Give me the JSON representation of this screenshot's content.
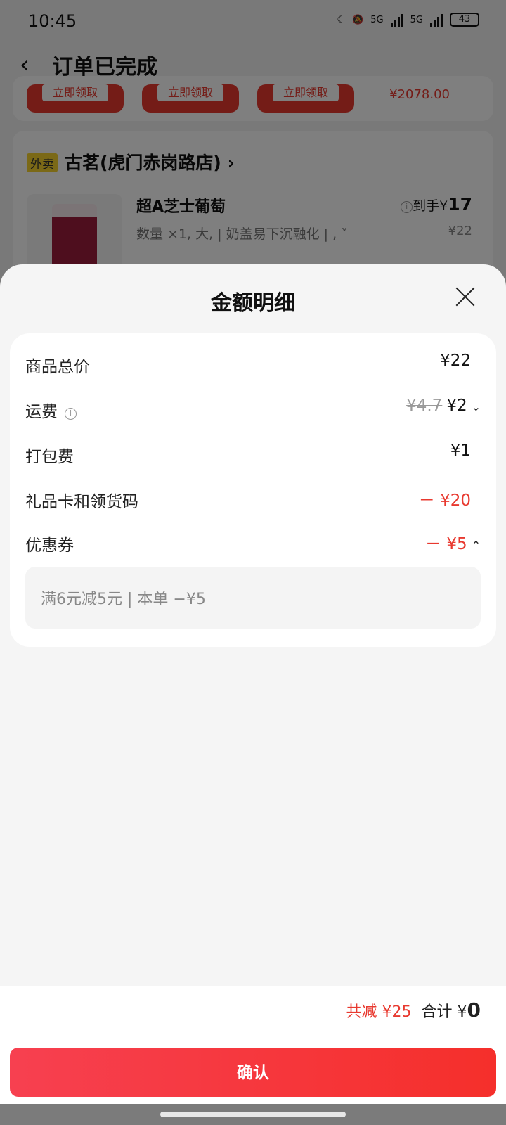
{
  "status_bar": {
    "time": "10:45",
    "battery": "43",
    "net1": "5G",
    "net2": "5G"
  },
  "header": {
    "title": "订单已完成"
  },
  "bg_card": {
    "buttons": [
      "立即领取",
      "立即领取",
      "立即领取"
    ],
    "price": "¥2078.00"
  },
  "order": {
    "tag": "外卖",
    "store": "古茗(虎门赤岗路店)",
    "product": {
      "name": "超A芝士葡萄",
      "spec": "数量 ×1, 大, | 奶盖易下沉融化 | ,",
      "net_label": "到手¥",
      "net_value": "17",
      "price": "¥22"
    }
  },
  "sheet": {
    "title": "金额明细",
    "rows": [
      {
        "label": "商品总价",
        "value": "¥22"
      },
      {
        "label": "运费",
        "original": "¥4.7",
        "value": "¥2"
      },
      {
        "label": "打包费",
        "value": "¥1"
      },
      {
        "label": "礼品卡和领货码",
        "value": "－ ¥20"
      },
      {
        "label": "优惠券",
        "value": "－ ¥5"
      }
    ],
    "coupon_detail": "满6元减5元 | 本单 −¥5"
  },
  "footer": {
    "saved": "共减 ¥25",
    "total_label": "合计 ¥",
    "total_value": "0",
    "confirm": "确认"
  },
  "colors": {
    "accent": "#e8392f",
    "button_start": "#f74050",
    "button_end": "#f52f2b"
  }
}
